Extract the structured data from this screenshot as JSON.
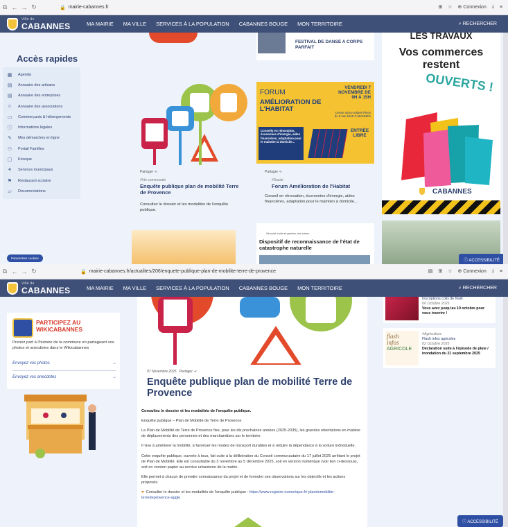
{
  "screen1": {
    "browser": {
      "url": "mairie-cabannes.fr",
      "connexion": "Connexion"
    },
    "nav": {
      "logo_small": "Ville de",
      "logo": "CABANNES",
      "items": [
        "MA MAIRIE",
        "MA VILLE",
        "SERVICES À LA POPULATION",
        "CABANNES BOUGE",
        "MON TERRITOIRE"
      ],
      "search": "RECHERCHER"
    },
    "quick_access": {
      "title": "Accès rapides",
      "items": [
        {
          "label": "Agenda",
          "icon": "calendar-icon"
        },
        {
          "label": "Annuaire des artisans",
          "icon": "book-icon"
        },
        {
          "label": "Annuaire des entreprises",
          "icon": "book-icon"
        },
        {
          "label": "Annuaire des associations",
          "icon": "people-icon"
        },
        {
          "label": "Commerçants & hébergements",
          "icon": "shop-icon"
        },
        {
          "label": "Informations légales",
          "icon": "info-icon"
        },
        {
          "label": "Mes démarches en ligne",
          "icon": "form-icon"
        },
        {
          "label": "Portail Familles",
          "icon": "family-icon"
        },
        {
          "label": "Kiosque",
          "icon": "newspaper-icon"
        },
        {
          "label": "Services municipaux",
          "icon": "services-icon"
        },
        {
          "label": "Restaurant scolaire",
          "icon": "restaurant-icon"
        },
        {
          "label": "Documentations",
          "icon": "folder-icon"
        }
      ],
      "settings_pill": "Paramètres cookies"
    },
    "top_card": {
      "title": "FESTIVAL DE DANSE A CORPS PARFAIT"
    },
    "news": [
      {
        "share": "Partager",
        "category": "#Vie communale",
        "title": "Enquête publique plan de mobilité Terre de Provence",
        "excerpt": "Consultez le dossier et les modalités de l'enquête publique."
      },
      {
        "share": "Partager",
        "category": "#Social",
        "title": "Forum Amélioration de l'Habitat",
        "excerpt": "Conseil en rénovation, économies d'énergie, aides financières, adaptation pour le maintien à domicile..."
      }
    ],
    "forum_poster": {
      "forum": "FORUM",
      "amelioration": "AMÉLIORATION DE L'HABITAT",
      "date": "VENDREDI 7 NOVEMBRE DE 9H À 15H",
      "place": "Centre socio-culturel Place du 8 mai 1945 CABANNES",
      "desc": "Conseils en rénovation, économies d'énergie, aides financières, adaptation pour le maintien à domicile...",
      "entree": "ENTRÉE LIBRE"
    },
    "bottom_card": {
      "small": "Sécurité civile et gestion des crises",
      "title": "Dispositif de reconnaissance de l'état de catastrophe naturelle"
    },
    "ad": {
      "top": "LES TRAVAUX",
      "line1": "Vos commerces",
      "line2": "restent",
      "ouverts": "OUVERTS !",
      "brand": "CABANNES"
    },
    "accessibility": "ACCESSIBILITÉ"
  },
  "screen2": {
    "browser": {
      "url": "mairie-cabannes.fr/actualites/206/enquete-publique-plan-de-mobilite-terre-de-provence",
      "connexion": "Connexion"
    },
    "wiki": {
      "title": "PARTICIPEZ AU WIKICABANNES",
      "desc": "Prenez part à l'histoire de la commune en partageant vos photos et anecdotes dans le Wikicabannes",
      "link1": "Envoyez vos photos",
      "link2": "Envoyez vos anecdotes"
    },
    "article": {
      "date": "07 Novembre 2025",
      "share": "Partager",
      "title": "Enquête publique plan de mobilité Terre de Provence",
      "lead": "Consultez le dossier et les modalités de l'enquête publique.",
      "p1": "Enquête publique – Plan de Mobilité de Terre de Provence",
      "p2": "Le Plan de Mobilité de Terre de Provence fixe, pour les dix prochaines années (2025-2035), les grandes orientations en matière de déplacements des personnes et des marchandises sur le territoire.",
      "p3": "Il vise à améliorer la mobilité, à favoriser les modes de transport durables et à réduire la dépendance à la voiture individuelle.",
      "p4": "Cette enquête publique, ouverte à tous, fait suite à la délibération du Conseil communautaire du 17 juillet 2025 arrêtant le projet de Plan de Mobilité. Elle est consultable du 3 novembre au 5 décembre 2025, soit en version numérique (voir lien ci-dessous), soit en version papier au service urbanisme de la mairie.",
      "p5": "Elle permet à chacun de prendre connaissance du projet et de formuler ses observations sur les objectifs et les actions proposés.",
      "link_intro": "Consulter le dossier et les modalités de l'enquête publique :",
      "link": "https://www.registre-numerique.fr/ plandemobilite-terredeprovence-agglo"
    },
    "sidebar": [
      {
        "date": "06 Octobre 2025",
        "title1": "Inscriptions colis de Noël",
        "title2": "Vous avez jusqu'au 19 octobre pour vous inscrire !"
      },
      {
        "category": "#Agriculture",
        "subtitle": "Flash infos agricoles",
        "date": "02 Octobre 2025",
        "title": "Déclaration suite à l'épisode de pluie / inondation du 21 septembre 2025"
      }
    ],
    "flash_image_text": [
      "flash",
      "infos",
      "AGRICOLE"
    ],
    "accessibility": "ACCESSIBILITÉ"
  }
}
